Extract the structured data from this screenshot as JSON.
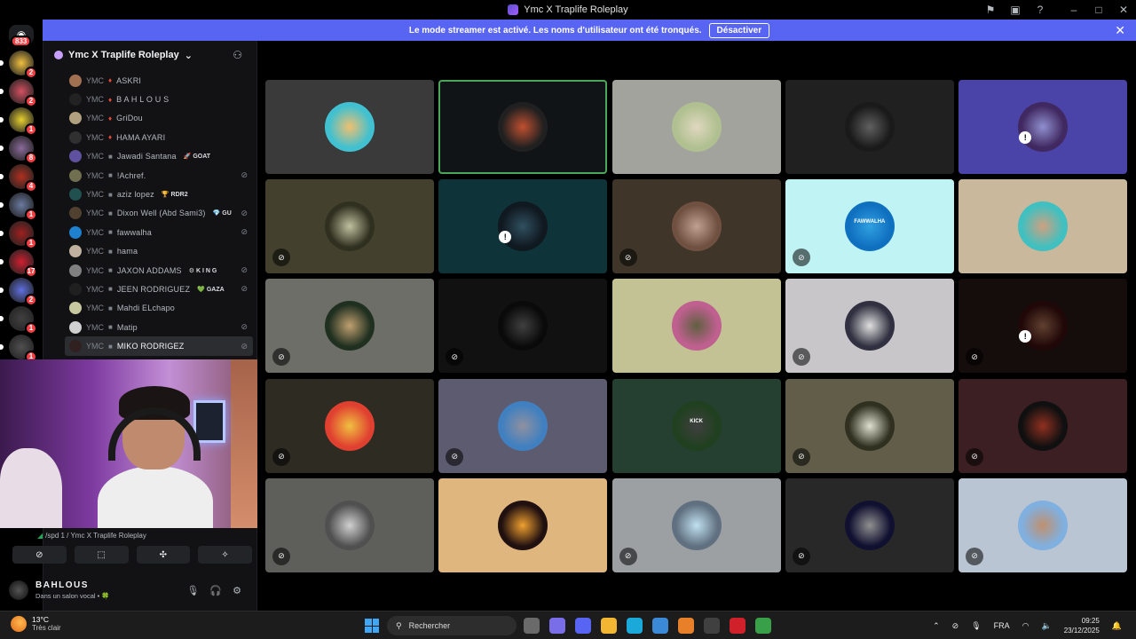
{
  "window": {
    "title": "Ymc X Traplife Roleplay"
  },
  "banner": {
    "text": "Le mode streamer est activé. Les noms d'utilisateur ont été tronqués.",
    "button": "Désactiver",
    "close": "✕"
  },
  "servers": {
    "home_badge": "833",
    "items": [
      {
        "badge": "2",
        "color": "#f0c040"
      },
      {
        "badge": "2",
        "color": "#d45060"
      },
      {
        "badge": "1",
        "color": "#e8d030"
      },
      {
        "badge": "8",
        "color": "#8a6a9a"
      },
      {
        "badge": "4",
        "color": "#b03020"
      },
      {
        "badge": "1",
        "color": "#6a7aa0"
      },
      {
        "badge": "1",
        "color": "#a02020"
      },
      {
        "badge": "17",
        "color": "#d02030"
      },
      {
        "badge": "2",
        "color": "#6070e0"
      },
      {
        "badge": "1",
        "color": "#404040"
      },
      {
        "badge": "1",
        "color": "#505050"
      }
    ]
  },
  "sidebar": {
    "server_name": "Ymc X Traplife Roleplay",
    "members": [
      {
        "tag": "YMC",
        "dot": "♦",
        "name": "ASKRI",
        "badge": "",
        "muted": false,
        "color": "#a07050"
      },
      {
        "tag": "YMC",
        "dot": "♦",
        "name": "B A H L O U S",
        "badge": "",
        "muted": false,
        "color": "#222222"
      },
      {
        "tag": "YMC",
        "dot": "♦",
        "name": "GriDou",
        "badge": "",
        "muted": false,
        "color": "#b0a080"
      },
      {
        "tag": "YMC",
        "dot": "♦",
        "name": "HAMA AYARI",
        "badge": "",
        "muted": false,
        "color": "#303030"
      },
      {
        "tag": "YMC",
        "dot": "■",
        "name": "Jawadi Santana",
        "badge": "🚀 GOAT",
        "muted": false,
        "color": "#6050a0"
      },
      {
        "tag": "YMC",
        "dot": "■",
        "name": "!Achref.",
        "badge": "",
        "muted": true,
        "color": "#707050"
      },
      {
        "tag": "YMC",
        "dot": "■",
        "name": "aziz lopez",
        "badge": "🏆 RDR2",
        "muted": false,
        "color": "#205050"
      },
      {
        "tag": "YMC",
        "dot": "■",
        "name": "Dixon Well (Abd Sami3)",
        "badge": "💎 GU",
        "muted": true,
        "color": "#504030"
      },
      {
        "tag": "YMC",
        "dot": "■",
        "name": "fawwalha",
        "badge": "",
        "muted": true,
        "color": "#2080d0"
      },
      {
        "tag": "YMC",
        "dot": "■",
        "name": "hama",
        "badge": "",
        "muted": false,
        "color": "#c0b0a0"
      },
      {
        "tag": "YMC",
        "dot": "■",
        "name": "JAXON ADDAMS",
        "badge": "⚙ K I N G",
        "muted": true,
        "color": "#808080"
      },
      {
        "tag": "YMC",
        "dot": "■",
        "name": "JEEN RODRIGUEZ",
        "badge": "💚 GAZA",
        "muted": true,
        "color": "#202020"
      },
      {
        "tag": "YMC",
        "dot": "■",
        "name": "Mahdi ELchapo",
        "badge": "",
        "muted": false,
        "color": "#c8c8a0"
      },
      {
        "tag": "YMC",
        "dot": "■",
        "name": "Matip",
        "badge": "",
        "muted": true,
        "color": "#d0d0d0"
      },
      {
        "tag": "YMC",
        "dot": "■",
        "name": "MIKO RODRIGEZ",
        "badge": "",
        "muted": true,
        "color": "#302020",
        "active": true
      }
    ]
  },
  "voice": {
    "status": "/spd 1 / Ymc X Traplife Roleplay",
    "buttons": [
      "⊘",
      "⬚",
      "✣",
      "✧"
    ]
  },
  "user": {
    "name": "BAHLOUS",
    "status": "Dans un salon vocal • 🍀",
    "mic": "🎙",
    "headset": "🎧",
    "settings": "⚙"
  },
  "tiles": [
    {
      "bg": "#3a3a3a",
      "av": "radial-gradient(circle,#f0c070 0,#40c0d0 60%)",
      "muted": false,
      "speaking": false
    },
    {
      "bg": "#111417",
      "av": "radial-gradient(circle,#c05030 0,#202020 60%)",
      "muted": false,
      "speaking": true
    },
    {
      "bg": "#a2a39c",
      "av": "radial-gradient(circle,#e0d8c0 0,#b0c090 60%)",
      "muted": false,
      "speaking": false
    },
    {
      "bg": "#202020",
      "av": "radial-gradient(circle,#606060 0,#1a1a1a 60%)",
      "muted": false,
      "speaking": false
    },
    {
      "bg": "#4b44a8",
      "av": "radial-gradient(circle,#9090d0 0,#402860 60%)",
      "muted": false,
      "speaking": false,
      "alert": true
    },
    {
      "bg": "#43412d",
      "av": "radial-gradient(circle,#c0c0a0 0,#303020 60%)",
      "muted": true,
      "speaking": false
    },
    {
      "bg": "#0e3338",
      "av": "radial-gradient(circle,#305060 0,#101820 60%)",
      "muted": false,
      "speaking": false,
      "alert": true
    },
    {
      "bg": "#3f3528",
      "av": "radial-gradient(circle,#c0a090 0,#705040 60%)",
      "muted": true,
      "speaking": false
    },
    {
      "bg": "#c0f3f4",
      "av": "radial-gradient(circle,#30a0e0 0,#1070c0 60%)",
      "muted": true,
      "speaking": false,
      "label": "FAWWALHA"
    },
    {
      "bg": "#c9b89b",
      "av": "radial-gradient(circle,#d0a080 0,#40c0c0 60%)",
      "muted": false,
      "speaking": false
    },
    {
      "bg": "#6c6e67",
      "av": "radial-gradient(circle,#c0a070 0,#203020 60%)",
      "muted": true,
      "speaking": false
    },
    {
      "bg": "#111111",
      "av": "radial-gradient(circle,#404040 0,#0a0a0a 60%)",
      "muted": true,
      "speaking": false
    },
    {
      "bg": "#c3c294",
      "av": "radial-gradient(circle,#606040 0,#c06090 60%)",
      "muted": false,
      "speaking": false
    },
    {
      "bg": "#c8c6c9",
      "av": "radial-gradient(circle,#e0e0e0 0,#303040 60%)",
      "muted": true,
      "speaking": false
    },
    {
      "bg": "#150d0b",
      "av": "radial-gradient(circle,#604030 0,#200808 60%)",
      "muted": true,
      "speaking": false,
      "alert": true
    },
    {
      "bg": "#2d2b22",
      "av": "radial-gradient(circle,#f0c040 0,#e04030 60%)",
      "muted": true,
      "speaking": false
    },
    {
      "bg": "#5d5b6f",
      "av": "radial-gradient(circle,#9090a0 0,#4080c0 60%)",
      "muted": true,
      "speaking": false
    },
    {
      "bg": "#254031",
      "av": "radial-gradient(circle,#404040 0,#204020 60%)",
      "muted": false,
      "speaking": false,
      "label": "KICK"
    },
    {
      "bg": "#615d48",
      "av": "radial-gradient(circle,#e0e0d0 0,#303020 60%)",
      "muted": true,
      "speaking": false
    },
    {
      "bg": "#3b1f22",
      "av": "radial-gradient(circle,#903020 0,#101010 60%)",
      "muted": true,
      "speaking": false
    },
    {
      "bg": "#5e5f5b",
      "av": "radial-gradient(circle,#d0d0d0 0,#505050 60%)",
      "muted": true,
      "speaking": false
    },
    {
      "bg": "#dfb77e",
      "av": "radial-gradient(circle,#f0a030 0,#201010 60%)",
      "muted": false,
      "speaking": false
    },
    {
      "bg": "#9da0a3",
      "av": "radial-gradient(circle,#c0e0f0 0,#607080 60%)",
      "muted": true,
      "speaking": false
    },
    {
      "bg": "#282828",
      "av": "radial-gradient(circle,#909090 0,#101030 60%)",
      "muted": true,
      "speaking": false
    },
    {
      "bg": "#b9c5d2",
      "av": "radial-gradient(circle,#c09070 0,#80b0e0 60%)",
      "muted": true,
      "speaking": false
    }
  ],
  "taskbar": {
    "temp": "13°C",
    "weather": "Très clair",
    "search": "Rechercher",
    "lang": "FRA",
    "time": "09:25",
    "date": "23/12/2025",
    "apps": [
      {
        "name": "task-view-icon",
        "color": "#6a6a6a"
      },
      {
        "name": "copilot-icon",
        "color": "#7a6ee8"
      },
      {
        "name": "discord-icon",
        "color": "#5865f2"
      },
      {
        "name": "file-explorer-icon",
        "color": "#f2b632"
      },
      {
        "name": "edge-icon",
        "color": "#1aa9d8"
      },
      {
        "name": "store-icon",
        "color": "#3a8ad8"
      },
      {
        "name": "vlc-icon",
        "color": "#e8802a"
      },
      {
        "name": "chrome-icon",
        "color": "#404040"
      },
      {
        "name": "app-red-icon",
        "color": "#d0202a"
      },
      {
        "name": "media-player-icon",
        "color": "#38a048"
      }
    ]
  }
}
